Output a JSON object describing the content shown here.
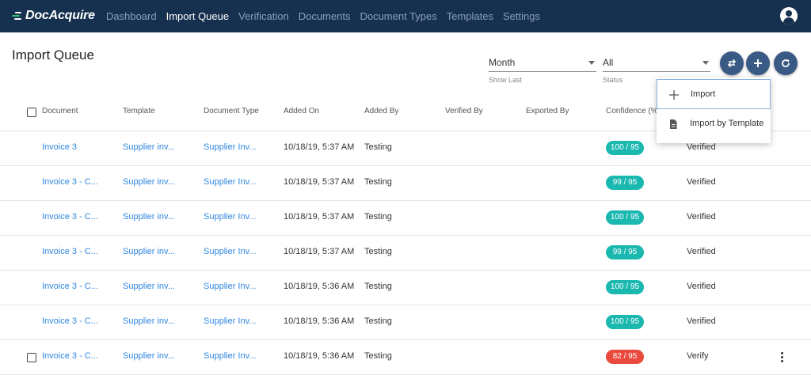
{
  "app": {
    "logo_text": "DocAcquire",
    "nav": [
      {
        "label": "Dashboard",
        "active": false
      },
      {
        "label": "Import Queue",
        "active": true
      },
      {
        "label": "Verification",
        "active": false
      },
      {
        "label": "Documents",
        "active": false
      },
      {
        "label": "Document Types",
        "active": false
      },
      {
        "label": "Templates",
        "active": false
      },
      {
        "label": "Settings",
        "active": false
      }
    ],
    "account_icon": "account-circle-icon"
  },
  "page": {
    "title": "Import Queue",
    "show_last": {
      "value": "Month",
      "label": "Show Last"
    },
    "status": {
      "value": "All",
      "label": "Status"
    },
    "actions": [
      {
        "icon": "swap-icon"
      },
      {
        "icon": "plus-icon"
      },
      {
        "icon": "refresh-icon"
      }
    ],
    "menu": [
      {
        "label": "Import",
        "icon": "plus-icon"
      },
      {
        "label": "Import by Template",
        "icon": "document-icon"
      }
    ]
  },
  "table": {
    "columns": [
      "Document",
      "Template",
      "Document Type",
      "Added On",
      "Added By",
      "Verified By",
      "Exported By",
      "Confidence (%)"
    ],
    "rows": [
      {
        "document": "Invoice 3",
        "template": "Supplier inv...",
        "doc_type": "Supplier Inv...",
        "added_on": "10/18/19, 5:37 AM",
        "added_by": "Testing",
        "confidence": "100 / 95",
        "conf_status": "ok",
        "status": "Verified",
        "checkbox": false,
        "menu": false
      },
      {
        "document": "Invoice 3 - C...",
        "template": "Supplier inv...",
        "doc_type": "Supplier Inv...",
        "added_on": "10/18/19, 5:37 AM",
        "added_by": "Testing",
        "confidence": "99 / 95",
        "conf_status": "ok",
        "status": "Verified",
        "checkbox": false,
        "menu": false
      },
      {
        "document": "Invoice 3 - C...",
        "template": "Supplier inv...",
        "doc_type": "Supplier Inv...",
        "added_on": "10/18/19, 5:37 AM",
        "added_by": "Testing",
        "confidence": "100 / 95",
        "conf_status": "ok",
        "status": "Verified",
        "checkbox": false,
        "menu": false
      },
      {
        "document": "Invoice 3 - C...",
        "template": "Supplier inv...",
        "doc_type": "Supplier Inv...",
        "added_on": "10/18/19, 5:37 AM",
        "added_by": "Testing",
        "confidence": "99 / 95",
        "conf_status": "ok",
        "status": "Verified",
        "checkbox": false,
        "menu": false
      },
      {
        "document": "Invoice 3 - C...",
        "template": "Supplier inv...",
        "doc_type": "Supplier Inv...",
        "added_on": "10/18/19, 5:36 AM",
        "added_by": "Testing",
        "confidence": "100 / 95",
        "conf_status": "ok",
        "status": "Verified",
        "checkbox": false,
        "menu": false
      },
      {
        "document": "Invoice 3 - C...",
        "template": "Supplier inv...",
        "doc_type": "Supplier Inv...",
        "added_on": "10/18/19, 5:36 AM",
        "added_by": "Testing",
        "confidence": "100 / 95",
        "conf_status": "ok",
        "status": "Verified",
        "checkbox": false,
        "menu": false
      },
      {
        "document": "Invoice 3 - C...",
        "template": "Supplier inv...",
        "doc_type": "Supplier Inv...",
        "added_on": "10/18/19, 5:36 AM",
        "added_by": "Testing",
        "confidence": "82 / 95",
        "conf_status": "low",
        "status": "Verify",
        "checkbox": true,
        "menu": true
      }
    ]
  },
  "colors": {
    "nav_bg": "#16304f",
    "nav_active": "#ffffff",
    "nav_inactive": "#8b9fbb",
    "link": "#2f86e0",
    "badge_ok": "#1bb8b0",
    "badge_low": "#ea4a3e",
    "fab": "#3a5a86"
  }
}
